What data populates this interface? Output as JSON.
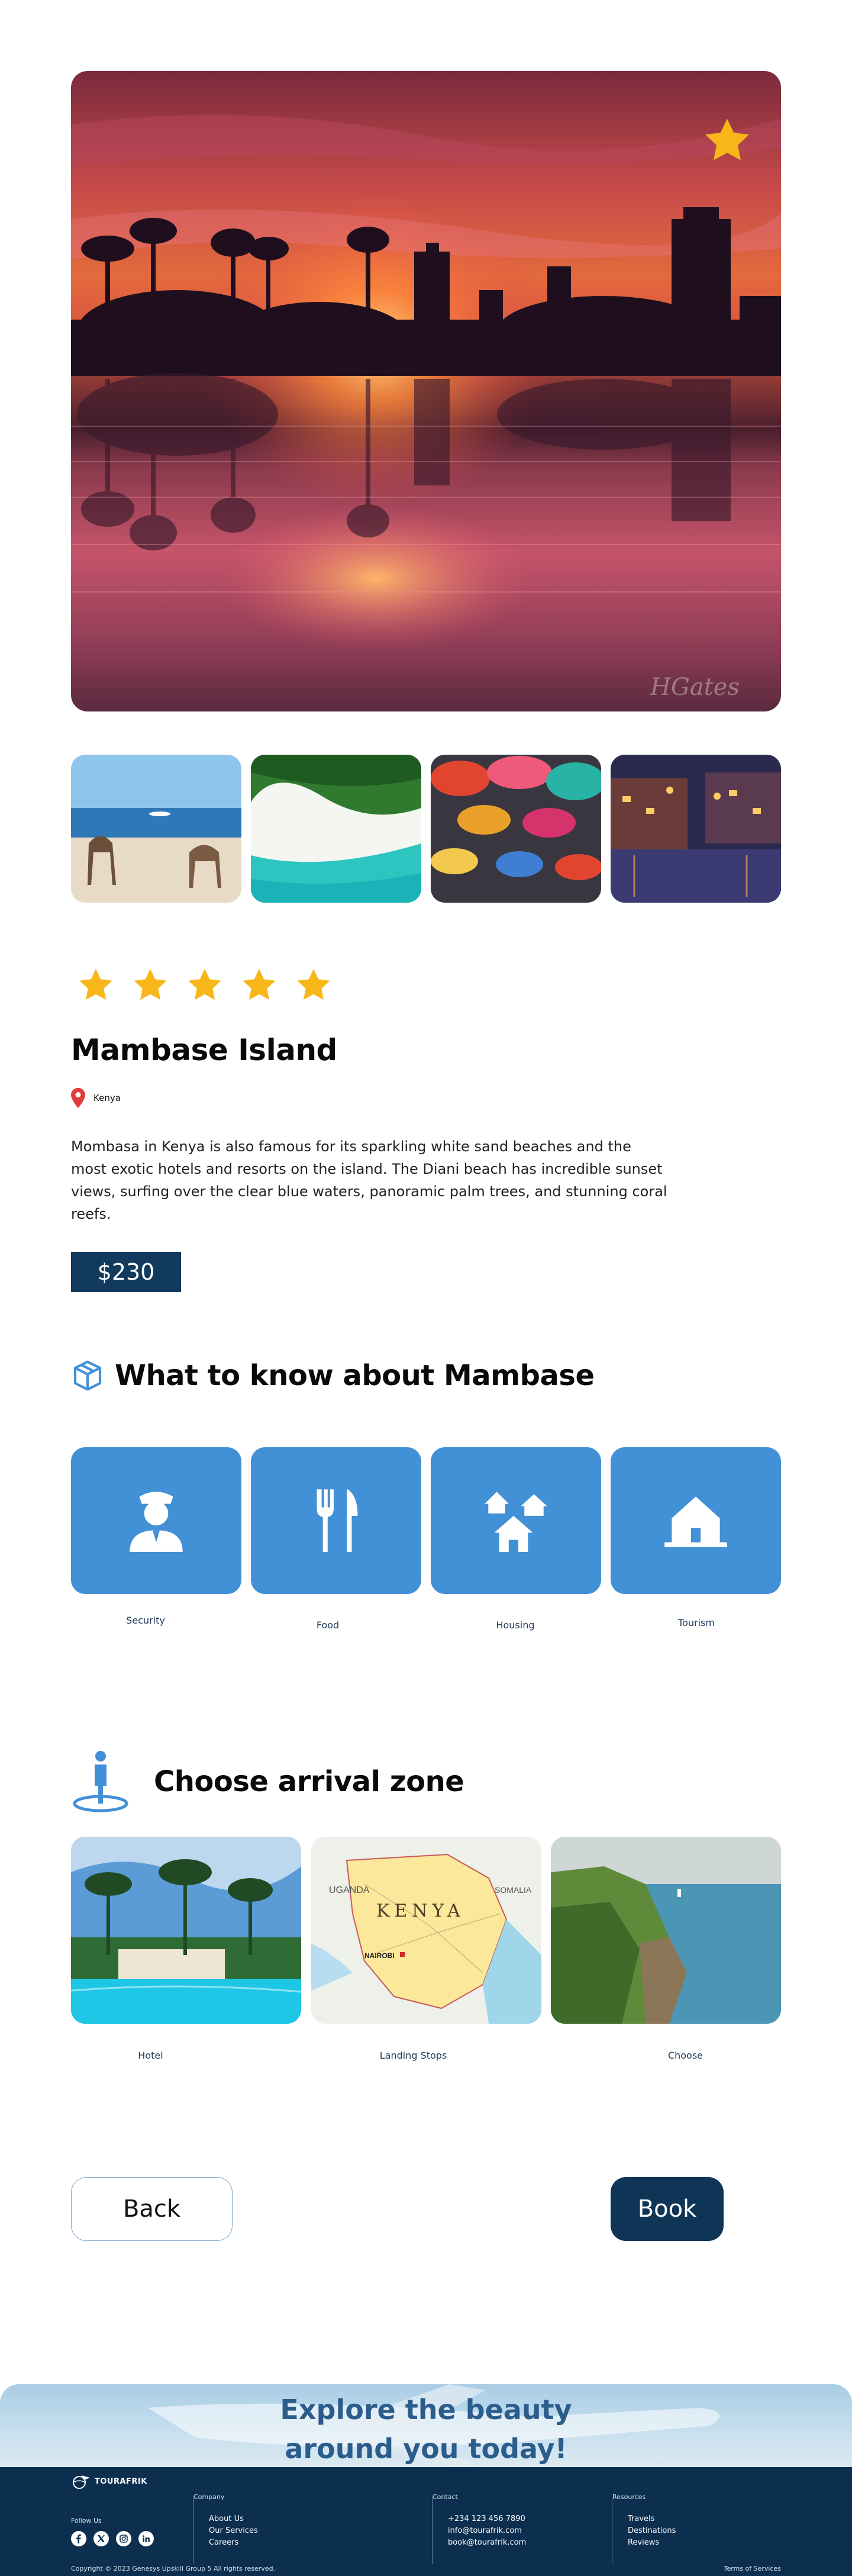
{
  "hero": {
    "favorite_icon": "star-icon",
    "watermark": "HGates",
    "colors": {
      "sky_top": "#7a2a3c",
      "sunset": "#e36a3c",
      "water": "#c5546a"
    }
  },
  "gallery": {
    "thumbnails": [
      "camels-on-beach",
      "white-sand-beach",
      "paper-lanterns",
      "canal-at-night"
    ]
  },
  "rating": {
    "stars": 5,
    "max": 5,
    "color": "#f7b718"
  },
  "destination": {
    "name": "Mambase Island",
    "location": "Kenya",
    "description": "Mombasa in Kenya is also famous for its sparkling white sand beaches and the most exotic hotels and resorts on the island. The Diani beach has incredible sunset views, surfing over the clear blue waters, panoramic palm trees, and stunning coral reefs.",
    "price": "$230"
  },
  "know_section": {
    "title": "What to know about Mambase",
    "icon": "box-icon",
    "cards": [
      {
        "label": "Security",
        "icon": "guard-icon"
      },
      {
        "label": "Food",
        "icon": "fork-knife-icon"
      },
      {
        "label": "Housing",
        "icon": "houses-icon"
      },
      {
        "label": "Tourism",
        "icon": "home-icon"
      }
    ],
    "card_color": "#4290d6"
  },
  "arrival_section": {
    "title": "Choose arrival zone",
    "icon": "person-pin-icon",
    "zones": [
      {
        "label": "Hotel"
      },
      {
        "label": "Landing Stops",
        "map_labels": {
          "country": "KENYA",
          "city": "NAIROBI",
          "north": "UGANDA",
          "east": "SOMALIA"
        }
      },
      {
        "label": "Choose"
      }
    ]
  },
  "actions": {
    "back": "Back",
    "book": "Book",
    "book_color": "#0f3556"
  },
  "banner": {
    "line1": "Explore the beauty",
    "line2": "around you today!"
  },
  "footer": {
    "brand": "TOURAFRIK",
    "follow_us": "Follow Us",
    "socials": [
      "facebook-icon",
      "x-icon",
      "instagram-icon",
      "linkedin-icon"
    ],
    "columns": [
      {
        "title": "Company",
        "items": [
          "About Us",
          "Our Services",
          "Careers"
        ]
      },
      {
        "title": "Contact",
        "items": [
          "+234 123 456 7890",
          "info@tourafrik.com",
          "book@tourafrik.com"
        ]
      },
      {
        "title": "Resources",
        "items": [
          "Travels",
          "Destinations",
          "Reviews"
        ]
      }
    ],
    "copyright": "Copyright © 2023 Genesys Upskill Group 5 All rights reserved.",
    "terms": "Terms of Services"
  }
}
